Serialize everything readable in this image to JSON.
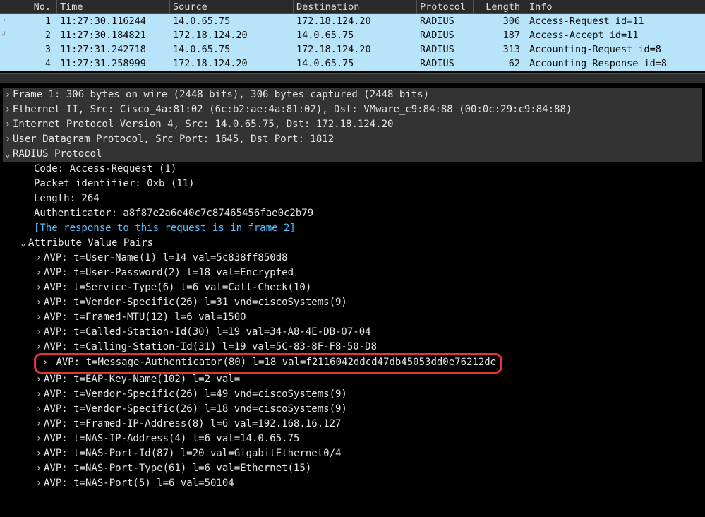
{
  "columns": {
    "no": "No.",
    "time": "Time",
    "src": "Source",
    "dst": "Destination",
    "proto": "Protocol",
    "len": "Length",
    "info": "Info"
  },
  "packets": [
    {
      "no": "1",
      "time": "11:27:30.116244",
      "src": "14.0.65.75",
      "dst": "172.18.124.20",
      "proto": "RADIUS",
      "len": "306",
      "info": "Access-Request id=11"
    },
    {
      "no": "2",
      "time": "11:27:30.184821",
      "src": "172.18.124.20",
      "dst": "14.0.65.75",
      "proto": "RADIUS",
      "len": "187",
      "info": "Access-Accept id=11"
    },
    {
      "no": "3",
      "time": "11:27:31.242718",
      "src": "14.0.65.75",
      "dst": "172.18.124.20",
      "proto": "RADIUS",
      "len": "313",
      "info": "Accounting-Request id=8"
    },
    {
      "no": "4",
      "time": "11:27:31.258999",
      "src": "172.18.124.20",
      "dst": "14.0.65.75",
      "proto": "RADIUS",
      "len": "62",
      "info": "Accounting-Response id=8"
    }
  ],
  "tree": {
    "frame": "Frame 1: 306 bytes on wire (2448 bits), 306 bytes captured (2448 bits)",
    "ethernet": "Ethernet II, Src: Cisco_4a:81:02 (6c:b2:ae:4a:81:02), Dst: VMware_c9:84:88 (00:0c:29:c9:84:88)",
    "ip": "Internet Protocol Version 4, Src: 14.0.65.75, Dst: 172.18.124.20",
    "udp": "User Datagram Protocol, Src Port: 1645, Dst Port: 1812",
    "radius": "RADIUS Protocol",
    "radius_fields": {
      "code": "Code: Access-Request (1)",
      "pkt_id": "Packet identifier: 0xb (11)",
      "length": "Length: 264",
      "authenticator": "Authenticator: a8f87e2a6e40c7c87465456fae0c2b79",
      "response_link": "[The response to this request is in frame 2]",
      "avps_label": "Attribute Value Pairs"
    },
    "avps": [
      "AVP: t=User-Name(1) l=14 val=5c838ff850d8",
      "AVP: t=User-Password(2) l=18 val=Encrypted",
      "AVP: t=Service-Type(6) l=6 val=Call-Check(10)",
      "AVP: t=Vendor-Specific(26) l=31 vnd=ciscoSystems(9)",
      "AVP: t=Framed-MTU(12) l=6 val=1500",
      "AVP: t=Called-Station-Id(30) l=19 val=34-A8-4E-DB-07-04",
      "AVP: t=Calling-Station-Id(31) l=19 val=5C-83-8F-F8-50-D8",
      "AVP: t=Message-Authenticator(80) l=18 val=f2116042ddcd47db45053dd0e76212de",
      "AVP: t=EAP-Key-Name(102) l=2 val=",
      "AVP: t=Vendor-Specific(26) l=49 vnd=ciscoSystems(9)",
      "AVP: t=Vendor-Specific(26) l=18 vnd=ciscoSystems(9)",
      "AVP: t=Framed-IP-Address(8) l=6 val=192.168.16.127",
      "AVP: t=NAS-IP-Address(4) l=6 val=14.0.65.75",
      "AVP: t=NAS-Port-Id(87) l=20 val=GigabitEthernet0/4",
      "AVP: t=NAS-Port-Type(61) l=6 val=Ethernet(15)",
      "AVP: t=NAS-Port(5) l=6 val=50104"
    ],
    "highlight_idx": 7
  },
  "glyph": {
    "collapsed": "›",
    "expanded": "⌄"
  }
}
